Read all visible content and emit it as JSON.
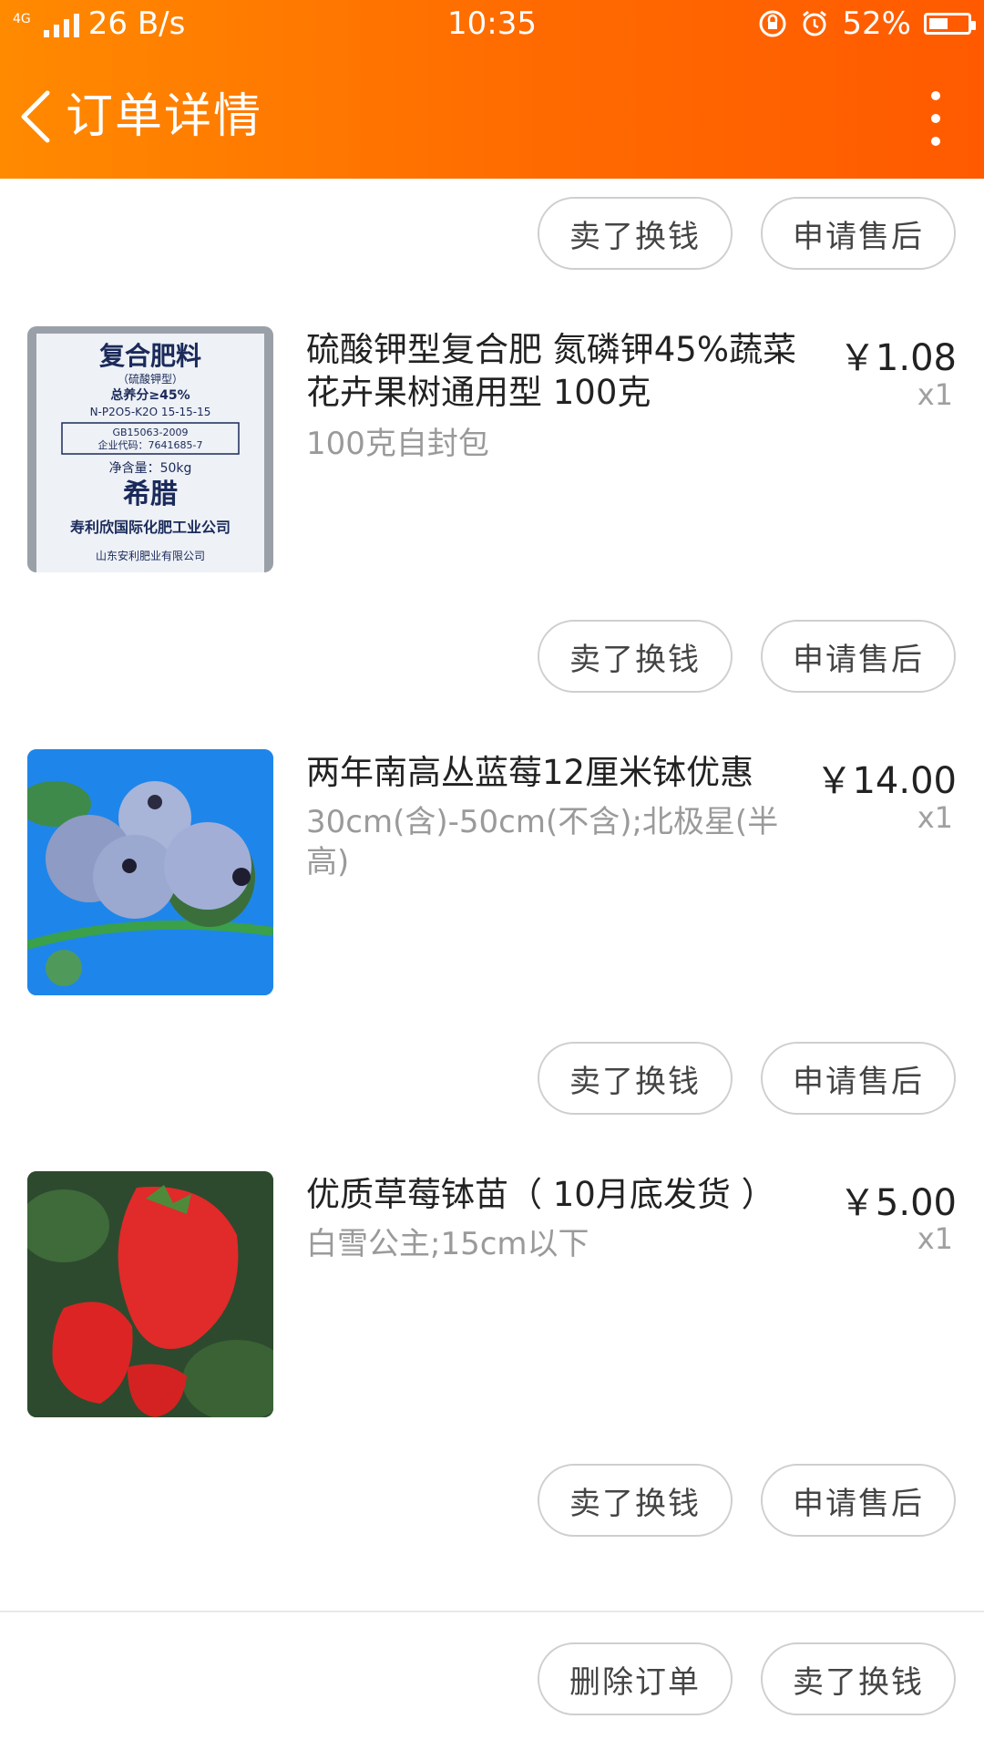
{
  "status_bar": {
    "network": "4G",
    "speed": "26 B/s",
    "time": "10:35",
    "battery": "52%"
  },
  "nav": {
    "title": "订单详情"
  },
  "buttons": {
    "sell": "卖了换钱",
    "after_sale": "申请售后",
    "delete_order": "删除订单"
  },
  "items": [
    {
      "title": "硫酸钾型复合肥 氮磷钾45%蔬菜花卉果树通用型 100克",
      "spec": "100克自封包",
      "price": "￥1.08",
      "qty": "x1",
      "image": "fertilizer-bag",
      "image_text": [
        "复合肥料",
        "（硫酸钾型）",
        "总养分≥45%",
        "N-P2O5-K2O 15-15-15",
        "GB15063-2009",
        "企业代码：7641685-7",
        "净含量：50kg",
        "希腊",
        "寿利欣国际化肥工业公司",
        "山东安利肥业有限公司"
      ]
    },
    {
      "title": "两年南高丛蓝莓12厘米钵优惠",
      "spec": "30cm(含)-50cm(不含);北极星(半高)",
      "price": "￥14.00",
      "qty": "x1",
      "image": "blueberries"
    },
    {
      "title": "优质草莓钵苗（ 10月底发货 ）",
      "spec": "白雪公主;15cm以下",
      "price": "￥5.00",
      "qty": "x1",
      "image": "strawberries"
    }
  ],
  "colors": {
    "header_start": "#ff8a00",
    "header_end": "#ff5a00"
  }
}
